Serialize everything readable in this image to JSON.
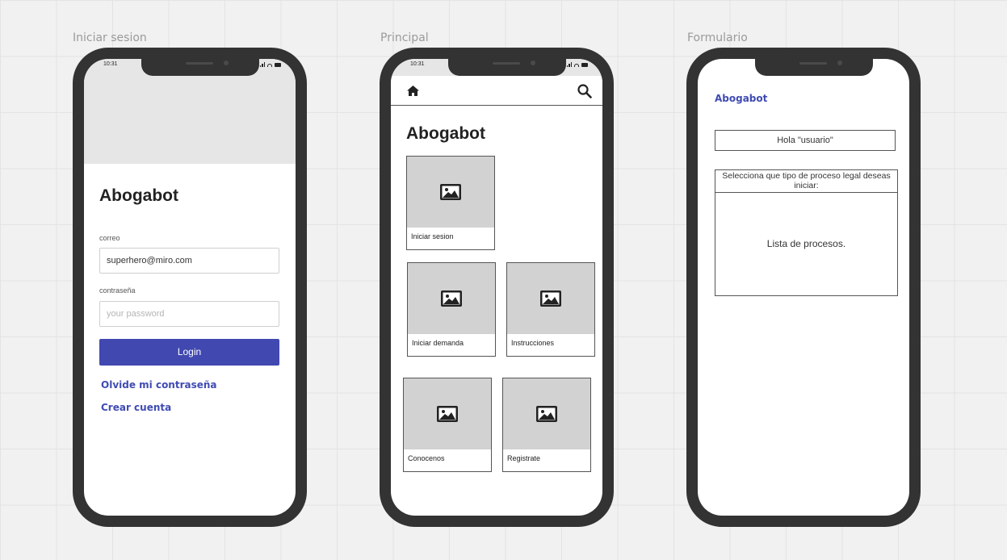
{
  "frames": [
    {
      "label": "Iniciar sesion"
    },
    {
      "label": "Principal"
    },
    {
      "label": "Formulario"
    }
  ],
  "status_bar": {
    "time": "10:31"
  },
  "login": {
    "title": "Abogabot",
    "email_label": "correo",
    "email_value": "superhero@miro.com",
    "password_label": "contraseña",
    "password_placeholder": "your password",
    "login_button": "Login",
    "forgot_link": "Olvide mi contraseña",
    "create_link": "Crear cuenta"
  },
  "principal": {
    "title": "Abogabot",
    "nav": {
      "home_icon": "home-icon",
      "search_icon": "search-icon"
    },
    "cards": [
      {
        "label": "Iniciar sesion",
        "icon": "image-icon"
      },
      {
        "label": "Iniciar demanda",
        "icon": "image-icon"
      },
      {
        "label": "Instrucciones",
        "icon": "image-icon"
      },
      {
        "label": "Conocenos",
        "icon": "image-icon"
      },
      {
        "label": "Registrate",
        "icon": "image-icon"
      }
    ]
  },
  "form": {
    "brand": "Abogabot",
    "greeting": "Hola \"usuario\"",
    "prompt": "Selecciona que tipo de proceso legal deseas iniciar:",
    "process_list": "Lista de procesos."
  },
  "colors": {
    "accent": "#4148b0",
    "link": "#3f4bb3",
    "phone_body": "#333333",
    "placeholder_gray": "#d2d2d2"
  }
}
